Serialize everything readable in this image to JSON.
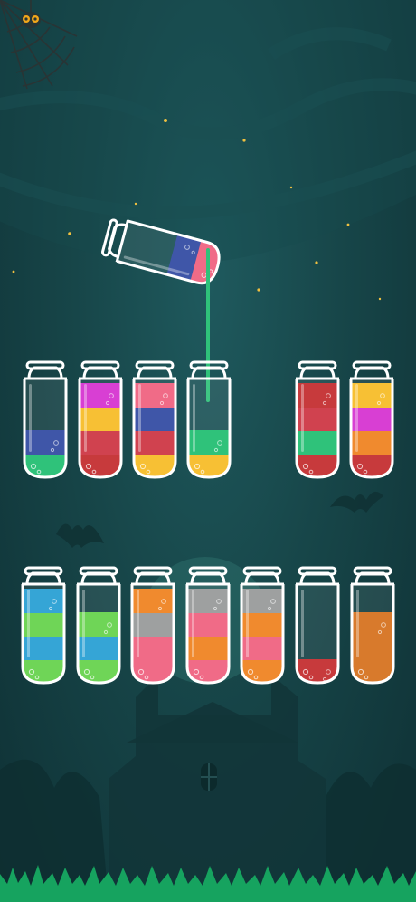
{
  "colors": {
    "blue": "#3f56a8",
    "green": "#2fc27a",
    "magenta": "#d83fd3",
    "yellow": "#f7c034",
    "red": "#d0424f",
    "pink": "#f06b87",
    "orange": "#f08a2e",
    "crimson": "#c73a3c",
    "sky": "#35a5d6",
    "lime": "#6fd557",
    "gray": "#9ea0a0",
    "brown": "#d87a2c"
  },
  "icons": {
    "spider_web": "spider-web-icon",
    "spider": "spider-icon",
    "bat": "bat-icon",
    "haunted_house": "haunted-house-icon",
    "moon": "moon-icon"
  },
  "poured_stream_color": "green",
  "poured_tube": {
    "layers": [
      "pink",
      "blue"
    ]
  },
  "rows": [
    {
      "tubes": [
        {
          "layers": [
            "green",
            "blue"
          ]
        },
        {
          "layers": [
            "crimson",
            "red",
            "yellow",
            "magenta"
          ]
        },
        {
          "layers": [
            "yellow",
            "red",
            "blue",
            "pink"
          ]
        },
        {
          "layers": [
            "yellow",
            "green"
          ]
        },
        {
          "layers": [
            "crimson",
            "green",
            "red",
            "crimson"
          ]
        },
        {
          "layers": [
            "crimson",
            "orange",
            "magenta",
            "yellow"
          ]
        }
      ]
    },
    {
      "tubes": [
        {
          "layers": [
            "lime",
            "sky",
            "lime",
            "sky"
          ]
        },
        {
          "layers": [
            "lime",
            "sky",
            "lime"
          ]
        },
        {
          "layers": [
            "pink",
            "pink",
            "gray",
            "orange"
          ]
        },
        {
          "layers": [
            "pink",
            "orange",
            "pink",
            "gray"
          ]
        },
        {
          "layers": [
            "orange",
            "pink",
            "orange",
            "gray"
          ]
        },
        {
          "layers": [
            "crimson"
          ]
        },
        {
          "layers": [
            "brown",
            "brown",
            "brown"
          ]
        }
      ]
    }
  ]
}
